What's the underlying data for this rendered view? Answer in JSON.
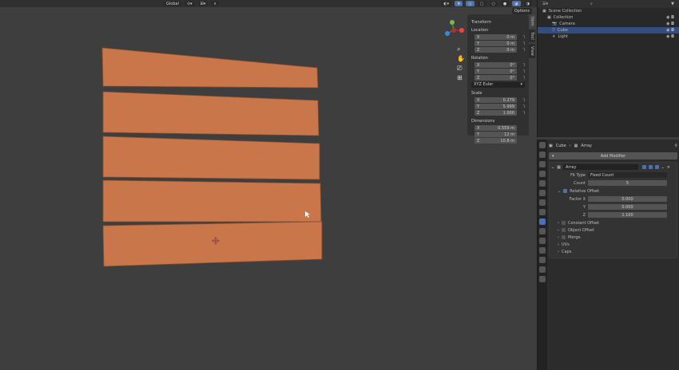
{
  "viewport_header": {
    "orientation": "Global",
    "options": "Options"
  },
  "npanel": {
    "title": "Transform",
    "location_label": "Location",
    "location": [
      [
        "X",
        "0 m"
      ],
      [
        "Y",
        "0 m"
      ],
      [
        "Z",
        "0 m"
      ]
    ],
    "rotation_label": "Rotation",
    "rotation": [
      [
        "X",
        "0°"
      ],
      [
        "Y",
        "0°"
      ],
      [
        "Z",
        "0°"
      ]
    ],
    "rotation_mode": "XYZ Euler",
    "scale_label": "Scale",
    "scale": [
      [
        "X",
        "0.279"
      ],
      [
        "Y",
        "5.999"
      ],
      [
        "Z",
        "1.000"
      ]
    ],
    "dimensions_label": "Dimensions",
    "dimensions": [
      [
        "X",
        "0.559 m"
      ],
      [
        "Y",
        "12 m"
      ],
      [
        "Z",
        "10.8 m"
      ]
    ],
    "tabs": [
      "Item",
      "Tool",
      "View"
    ]
  },
  "outliner": {
    "items": [
      {
        "label": "Scene Collection"
      },
      {
        "label": "Collection"
      },
      {
        "label": "Camera"
      },
      {
        "label": "Cube",
        "active": true
      },
      {
        "label": "Light"
      }
    ]
  },
  "properties": {
    "breadcrumb": {
      "object": "Cube",
      "modifier": "Array"
    },
    "add_modifier": "Add Modifier",
    "modifier": {
      "name": "Array",
      "fit_type_label": "Fit Type",
      "fit_type": "Fixed Count",
      "count_label": "Count",
      "count": "5",
      "relative_offset": "Relative Offset",
      "factor": [
        [
          "Factor X",
          "0.000"
        ],
        [
          "Y",
          "0.000"
        ],
        [
          "Z",
          "1.100"
        ]
      ],
      "subpanels": [
        "Constant Offset",
        "Object Offset",
        "Merge",
        "UVs",
        "Caps"
      ]
    }
  },
  "colors": {
    "plank": "#c8764a",
    "accent": "#4772b3",
    "viewport": "#3e3e3e"
  }
}
